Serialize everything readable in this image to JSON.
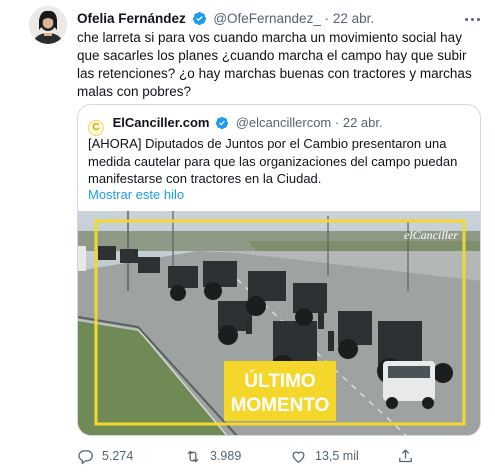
{
  "tweet": {
    "author_name": "Ofelia Fernández",
    "handle": "@OfeFernandez_",
    "separator": "·",
    "date": "22 abr.",
    "text": "che larreta si para vos cuando marcha un movimiento social hay que sacarles los planes ¿cuando marcha el campo hay que subir las retenciones? ¿o hay marchas buenas con tractores y marchas malas con pobres?",
    "more_icon": "ellipsis-icon"
  },
  "quote": {
    "logo_letter": "C",
    "author_name": "ElCanciller.com",
    "handle": "@elcancillercom",
    "separator": "·",
    "date": "22 abr.",
    "text": "[AHORA] Diputados de Juntos por el Cambio presentaron una medida cautelar para que las organizaciones del campo puedan manifestarse con tractores en la Ciudad.",
    "show_thread": "Mostrar este hilo",
    "image": {
      "watermark": "elCanciller",
      "banner_line1": "ÚLTIMO",
      "banner_line2": "MOMENTO"
    }
  },
  "actions": {
    "replies": "5.274",
    "retweets": "3.989",
    "likes": "13,5 mil"
  },
  "colors": {
    "accent": "#1d9bf0",
    "muted": "#536471",
    "banner": "#f5d62b"
  }
}
